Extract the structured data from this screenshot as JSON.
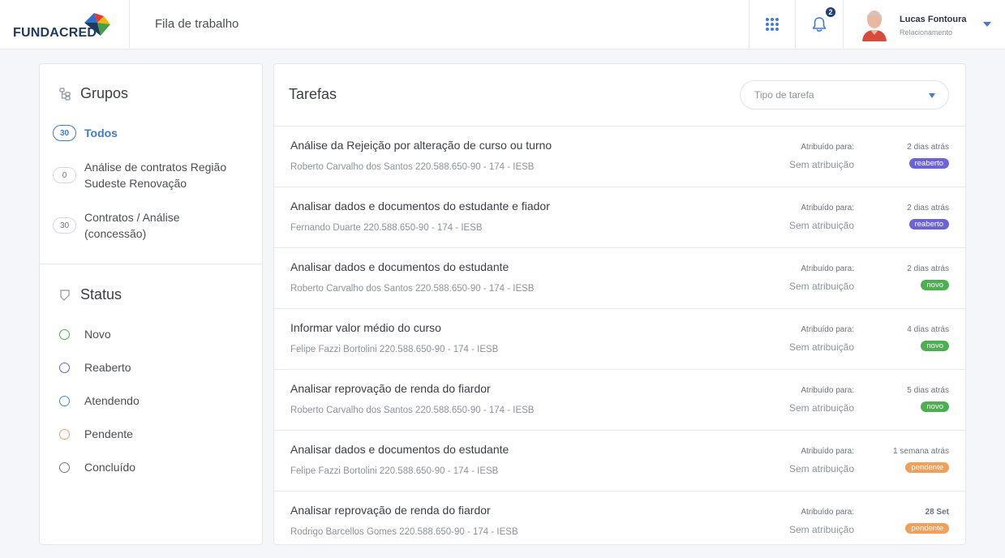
{
  "app": {
    "logo_text": "FUNDACRED",
    "page_title": "Fila de trabalho",
    "notifications_count": "2",
    "user": {
      "name": "Lucas Fontoura",
      "role": "Relacionamento"
    }
  },
  "colors": {
    "accent": "#3e7bd6",
    "novo": "#4caf50",
    "reaberto": "#6c63d9",
    "atendendo": "#3e8fd6",
    "pendente": "#f0a05a",
    "concluido": "#707780"
  },
  "groups": {
    "title": "Grupos",
    "items": [
      {
        "count": "30",
        "label": "Todos"
      },
      {
        "count": "0",
        "label": "Análise de contratos Região Sudeste Renovação"
      },
      {
        "count": "30",
        "label": "Contratos / Análise (concessão)"
      }
    ]
  },
  "status": {
    "title": "Status",
    "items": [
      {
        "label": "Novo"
      },
      {
        "label": "Reaberto"
      },
      {
        "label": "Atendendo"
      },
      {
        "label": "Pendente"
      },
      {
        "label": "Concluído"
      }
    ]
  },
  "tasks_panel": {
    "title": "Tarefas",
    "filter_placeholder": "Tipo de tarefa"
  },
  "tasks": [
    {
      "title": "Análise da Rejeição por alteração de curso ou turno",
      "subtitle": "Roberto Carvalho dos Santos 220.588.650-90 - 174 - IESB",
      "assigned_label": "Atribuído para:",
      "assigned_value": "Sem atribuição",
      "time": "2 dias atrás",
      "badge": "reaberto"
    },
    {
      "title": "Analisar dados e documentos do estudante e fiador",
      "subtitle": "Fernando Duarte 220.588.650-90 - 174 - IESB",
      "assigned_label": "Atribuído para:",
      "assigned_value": "Sem atribuição",
      "time": "2 dias atrás",
      "badge": "reaberto"
    },
    {
      "title": "Analisar dados e documentos do estudante",
      "subtitle": "Roberto Carvalho dos Santos 220.588.650-90 - 174 - IESB",
      "assigned_label": "Atribuído para:",
      "assigned_value": "Sem atribuição",
      "time": "2 dias atrás",
      "badge": "novo"
    },
    {
      "title": "Informar valor médio do curso",
      "subtitle": "Felipe Fazzi Bortolini 220.588.650-90 - 174 - IESB",
      "assigned_label": "Atribuído para:",
      "assigned_value": "Sem atribuição",
      "time": "4 dias atrás",
      "badge": "novo"
    },
    {
      "title": "Analisar reprovação de renda do fiardor",
      "subtitle": "Roberto Carvalho dos Santos 220.588.650-90 - 174 - IESB",
      "assigned_label": "Atribuído para:",
      "assigned_value": "Sem atribuição",
      "time": "5 dias atrás",
      "badge": "novo"
    },
    {
      "title": "Analisar dados e documentos do estudante",
      "subtitle": "Felipe Fazzi Bortolini 220.588.650-90 - 174 - IESB",
      "assigned_label": "Atribuído para:",
      "assigned_value": "Sem atribuição",
      "time": "1 semana atrás",
      "badge": "pendente"
    },
    {
      "title": "Analisar reprovação de renda do fiardor",
      "subtitle": "Rodrigo Barcellos Gomes 220.588.650-90 - 174 - IESB",
      "assigned_label": "Atribuído para:",
      "assigned_value": "Sem atribuição",
      "time": "28 Set",
      "badge": "pendente"
    }
  ]
}
